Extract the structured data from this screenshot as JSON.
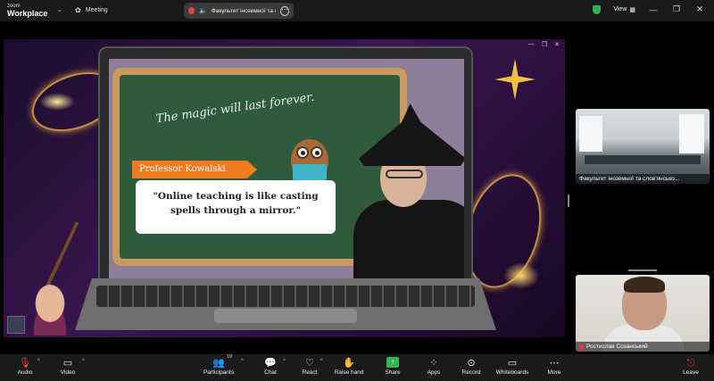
{
  "titlebar": {
    "logo_top": "zoom",
    "logo_bottom": "Workplace",
    "meeting_label": "Meeting",
    "share_title": "Факультет іноземної та сло",
    "view_label": "View"
  },
  "slide": {
    "tagline": "The magic will last forever.",
    "professor": "Professor Kowalski",
    "quote": "\"Online teaching is like casting spells through a mirror.\""
  },
  "participants": {
    "tile1_name": "Факультет іноземної та слов'янсько...",
    "tile2_name": "Ростислав Созанський"
  },
  "toolbar": {
    "audio": "Audio",
    "video": "Video",
    "participants": "Participants",
    "participants_count": "19",
    "chat": "Chat",
    "react": "React",
    "raise_hand": "Raise hand",
    "share": "Share",
    "apps": "Apps",
    "record": "Record",
    "whiteboards": "Whiteboards",
    "more": "More",
    "leave": "Leave"
  },
  "colors": {
    "accent_green": "#2fb84f",
    "leave_red": "#ff3344",
    "tab_orange": "#f07b22"
  },
  "icons": {
    "audio": "mic-muted-icon",
    "video": "camera-icon",
    "participants": "people-icon",
    "chat": "chat-icon",
    "react": "heart-icon",
    "raise_hand": "hand-icon",
    "share": "share-arrow-icon",
    "apps": "apps-icon",
    "record": "record-icon",
    "whiteboards": "whiteboard-icon",
    "more": "more-dots-icon",
    "leave": "leave-icon"
  }
}
